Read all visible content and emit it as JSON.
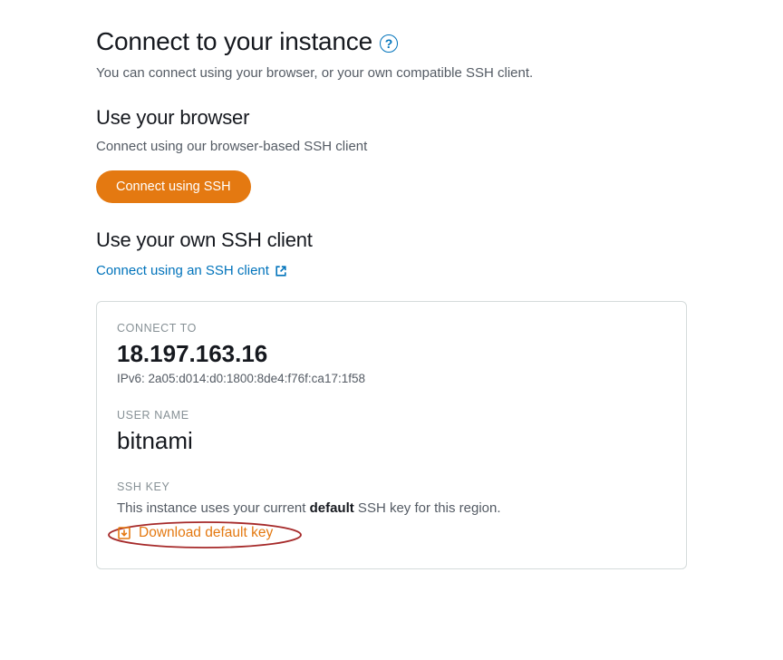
{
  "header": {
    "title": "Connect to your instance",
    "subtitle": "You can connect using your browser, or your own compatible SSH client."
  },
  "browser_section": {
    "heading": "Use your browser",
    "desc": "Connect using our browser-based SSH client",
    "button_label": "Connect using SSH"
  },
  "ssh_section": {
    "heading": "Use your own SSH client",
    "link_label": "Connect using an SSH client"
  },
  "panel": {
    "connect_to_label": "CONNECT TO",
    "ip": "18.197.163.16",
    "ipv6_prefix": "IPv6: ",
    "ipv6": "2a05:d014:d0:1800:8de4:f76f:ca17:1f58",
    "username_label": "USER NAME",
    "username": "bitnami",
    "sshkey_label": "SSH KEY",
    "sshkey_text_pre": "This instance uses your current ",
    "sshkey_text_bold": "default",
    "sshkey_text_post": " SSH key for this region.",
    "download_label": "Download default key"
  },
  "colors": {
    "accent_orange": "#e47911",
    "link_blue": "#0073bb",
    "annotation_red": "#a62a2a"
  }
}
